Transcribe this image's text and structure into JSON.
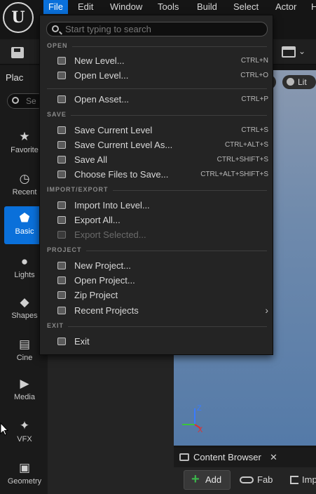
{
  "menubar": {
    "logo_letter": "U",
    "items": [
      {
        "label": "File",
        "active": true
      },
      {
        "label": "Edit"
      },
      {
        "label": "Window"
      },
      {
        "label": "Tools"
      },
      {
        "label": "Build"
      },
      {
        "label": "Select"
      },
      {
        "label": "Actor"
      },
      {
        "label": "H"
      }
    ]
  },
  "place_panel": {
    "tab_label": "Plac",
    "search_placeholder": "Se",
    "categories": [
      {
        "label": "Favorite",
        "icon": "star-icon"
      },
      {
        "label": "Recent",
        "icon": "clock-icon"
      },
      {
        "label": "Basic",
        "icon": "shapes-icon",
        "active": true
      },
      {
        "label": "Lights",
        "icon": "bulb-icon"
      },
      {
        "label": "Shapes",
        "icon": "cube-icon"
      },
      {
        "label": "Cine",
        "icon": "clapper-icon"
      },
      {
        "label": "Media",
        "icon": "media-icon"
      },
      {
        "label": "VFX",
        "icon": "sparkle-icon"
      },
      {
        "label": "Geometry",
        "icon": "geometry-icon"
      }
    ]
  },
  "viewport": {
    "lit_label": "Lit",
    "axis_z": "Z",
    "axis_x": "X"
  },
  "content_browser": {
    "tab_label": "Content Browser",
    "close_glyph": "✕",
    "add_label": "Add",
    "fab_label": "Fab",
    "import_label": "Imp"
  },
  "file_menu": {
    "search_placeholder": "Start typing to search",
    "sections": {
      "open": "OPEN",
      "save": "SAVE",
      "import_export": "IMPORT/EXPORT",
      "project": "PROJECT",
      "exit": "EXIT"
    },
    "items": {
      "new_level": {
        "label": "New Level...",
        "shortcut": "CTRL+N"
      },
      "open_level": {
        "label": "Open Level...",
        "shortcut": "CTRL+O"
      },
      "open_asset": {
        "label": "Open Asset...",
        "shortcut": "CTRL+P"
      },
      "save_current": {
        "label": "Save Current Level",
        "shortcut": "CTRL+S"
      },
      "save_current_as": {
        "label": "Save Current Level As...",
        "shortcut": "CTRL+ALT+S"
      },
      "save_all": {
        "label": "Save All",
        "shortcut": "CTRL+SHIFT+S"
      },
      "choose_files": {
        "label": "Choose Files to Save...",
        "shortcut": "CTRL+ALT+SHIFT+S"
      },
      "import_into_level": {
        "label": "Import Into Level..."
      },
      "export_all": {
        "label": "Export All..."
      },
      "export_selected": {
        "label": "Export Selected...",
        "disabled": true
      },
      "new_project": {
        "label": "New Project..."
      },
      "open_project": {
        "label": "Open Project..."
      },
      "zip_project": {
        "label": "Zip Project"
      },
      "recent_projects": {
        "label": "Recent Projects",
        "submenu_glyph": "›"
      },
      "exit": {
        "label": "Exit"
      }
    }
  }
}
